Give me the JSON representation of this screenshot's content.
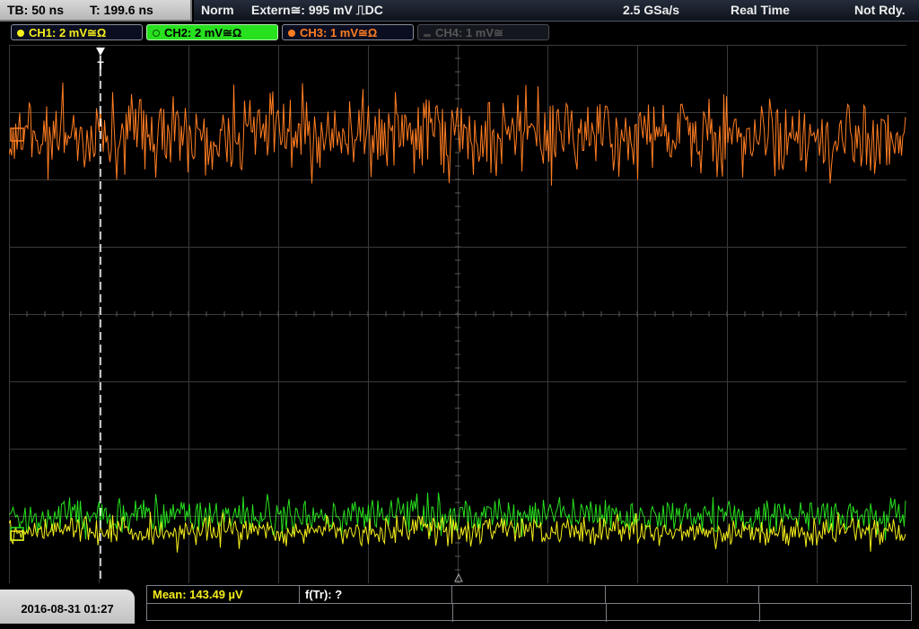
{
  "header": {
    "timebase": "TB: 50 ns",
    "trigger_time": "T: 199.6 ns",
    "mode": "Norm",
    "trigger_source": "Extern≅: 995 mV ⎍DC",
    "sample_rate": "2.5 GSa/s",
    "acq_mode": "Real Time",
    "status": "Not Rdy."
  },
  "channels": [
    {
      "label": "CH1: 2 mV≅Ω",
      "color": "#f6ef1b",
      "state": "on"
    },
    {
      "label": "CH2: 2 mV≅Ω",
      "color": "#27e01e",
      "state": "selected"
    },
    {
      "label": "CH3: 1 mV≅Ω",
      "color": "#ff7d22",
      "state": "on"
    },
    {
      "label": "CH4: 1 mV≅",
      "color": "#555555",
      "state": "off"
    }
  ],
  "trigger_marker": "T",
  "footer": {
    "datetime": "2016-08-31 01:27",
    "measurements": [
      {
        "label": "Mean: 143.49 µV",
        "color": "#f6ef1b"
      },
      {
        "label": "f(Tr): ?",
        "color": "#ffffff"
      }
    ]
  },
  "icons": {
    "channel-dot": "●",
    "trigger-arrow": "▼",
    "trigger-level": "△"
  }
}
